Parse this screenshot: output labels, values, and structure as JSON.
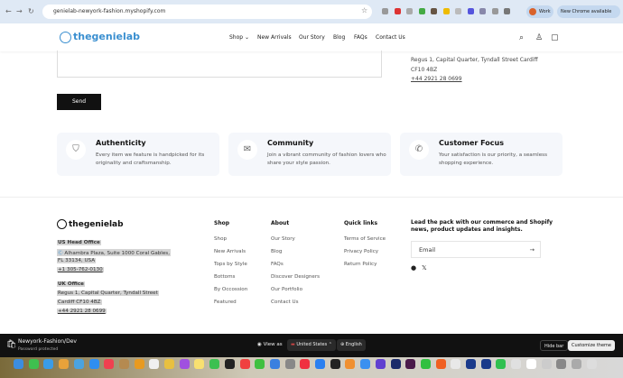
{
  "browser": {
    "url": "genielab-newyork-fashion.myshopify.com",
    "profile": "Work",
    "update": "New Chrome available"
  },
  "header": {
    "logo": "thegenielab",
    "nav": [
      "Shop",
      "New Arrivals",
      "Our Story",
      "Blog",
      "FAQs",
      "Contact Us"
    ]
  },
  "contact": {
    "address1": "Regus 1, Capital Quarter, Tyndall Street  Cardiff",
    "address2": "CF10 4BZ",
    "phone": "+44 2921 28 0699",
    "send": "Send"
  },
  "features": [
    {
      "icon": "shield-check-icon",
      "title": "Authenticity",
      "desc": "Every item we feature is handpicked for its originality and craftsmanship."
    },
    {
      "icon": "envelope-icon",
      "title": "Community",
      "desc": "Join a vibrant community of fashion lovers who share your style passion."
    },
    {
      "icon": "phone-icon",
      "title": "Customer Focus",
      "desc": "Your satisfaction is our priority, a seamless shopping experience."
    }
  ],
  "footer": {
    "logo": "thegenielab",
    "us": {
      "title": "US Head Office",
      "line1": "Alhambra Plaza, Suite 1000 Coral Gables,",
      "line2": "FL 33134, USA",
      "phone": "+1 305-762-0130"
    },
    "uk": {
      "title": "UK Office",
      "line1": "Regus 1, Capital Quarter, Tyndall Street",
      "line2": "Cardiff  CF10 4BZ",
      "phone": "+44 2921 28 0699"
    },
    "columns": [
      {
        "title": "Shop",
        "links": [
          "Shop",
          "New Arrivals",
          "Tops by Style",
          "Bottoms",
          "By Occossion",
          "Featured"
        ]
      },
      {
        "title": "About",
        "links": [
          "Our Story",
          "Blog",
          "FAQs",
          "Discover Designers",
          "Our Portfolio",
          "Contact Us"
        ]
      },
      {
        "title": "Quick links",
        "links": [
          "Terms of Service",
          "Privacy Policy",
          "Return Policy"
        ]
      }
    ],
    "newsletter": {
      "title": "Lead the pack with our commerce and Shopify news, product updates and insights.",
      "placeholder": "Email"
    }
  },
  "shopify_bar": {
    "store": "Newyork-Fashion/Dev",
    "status": "Password protected",
    "view_as": "View as",
    "country": "United States",
    "language": "English",
    "hide": "Hide bar",
    "customize": "Customize theme"
  },
  "dock_colors": [
    "#3b8de0",
    "#3fc04f",
    "#3a9ce8",
    "#e8a23a",
    "#4aa3e0",
    "#2f8ef0",
    "#f04050",
    "#b58a50",
    "#e89a20",
    "#f0f0f0",
    "#e8c040",
    "#a050e0",
    "#f8e070",
    "#3cc050",
    "#222",
    "#f04040",
    "#40c040",
    "#3a80e0",
    "#888",
    "#f03040",
    "#2a80f0",
    "#222",
    "#f09030",
    "#3a90f0",
    "#6040d0",
    "#1a2a6a",
    "#4a1a4a",
    "#30c040",
    "#f06020",
    "#e8e8e8",
    "#1a3a8a",
    "#1a3a8a",
    "#30c050",
    "#e0e0e0",
    "#fff",
    "#ccc",
    "#888",
    "#aaa",
    "#ddd"
  ]
}
